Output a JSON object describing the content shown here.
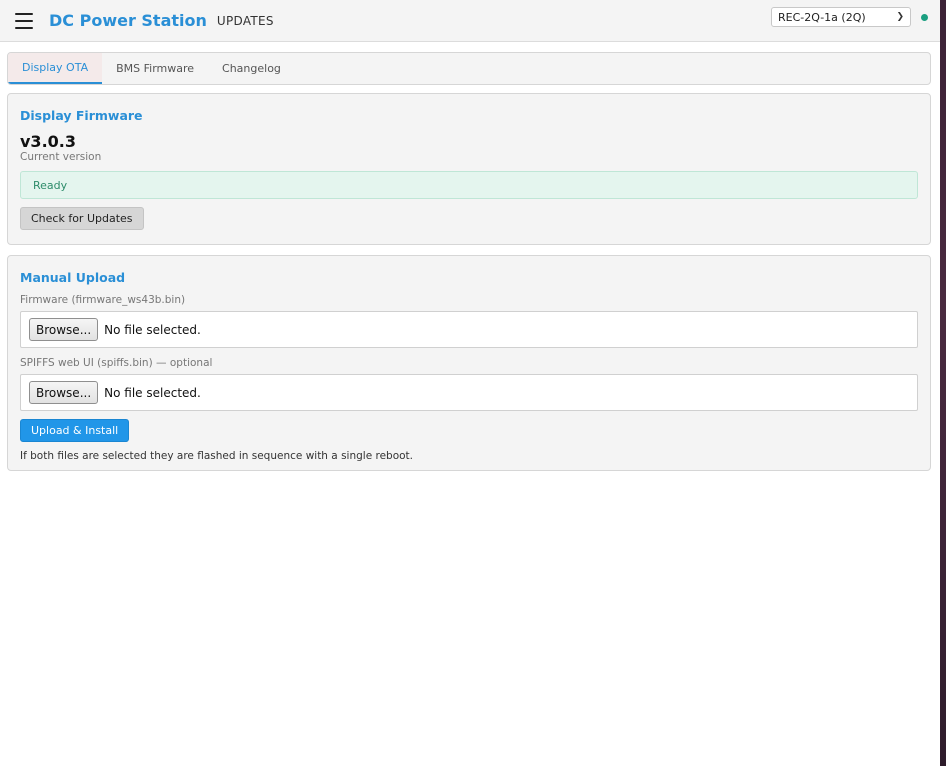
{
  "header": {
    "brand": "DC Power Station",
    "page_label": "UPDATES",
    "device_select": {
      "selected": "REC-2Q-1a (2Q)"
    },
    "status_dot_color": "#1a9f80"
  },
  "tabs": [
    {
      "label": "Display OTA",
      "active": true
    },
    {
      "label": "BMS Firmware",
      "active": false
    },
    {
      "label": "Changelog",
      "active": false
    }
  ],
  "display_firmware": {
    "title": "Display Firmware",
    "version": "v3.0.3",
    "version_caption": "Current version",
    "status": "Ready",
    "check_button": "Check for Updates"
  },
  "manual_upload": {
    "title": "Manual Upload",
    "firmware_label": "Firmware (firmware_ws43b.bin)",
    "firmware_browse": "Browse...",
    "firmware_status": "No file selected.",
    "spiffs_label": "SPIFFS web UI (spiffs.bin) — optional",
    "spiffs_browse": "Browse...",
    "spiffs_status": "No file selected.",
    "upload_button": "Upload & Install",
    "note": "If both files are selected they are flashed in sequence with a single reboot."
  },
  "colors": {
    "accent": "#2a8fd6",
    "primary_button": "#2196e8",
    "ready_text": "#2e8c6a",
    "ready_bg": "#e4f5ee"
  }
}
